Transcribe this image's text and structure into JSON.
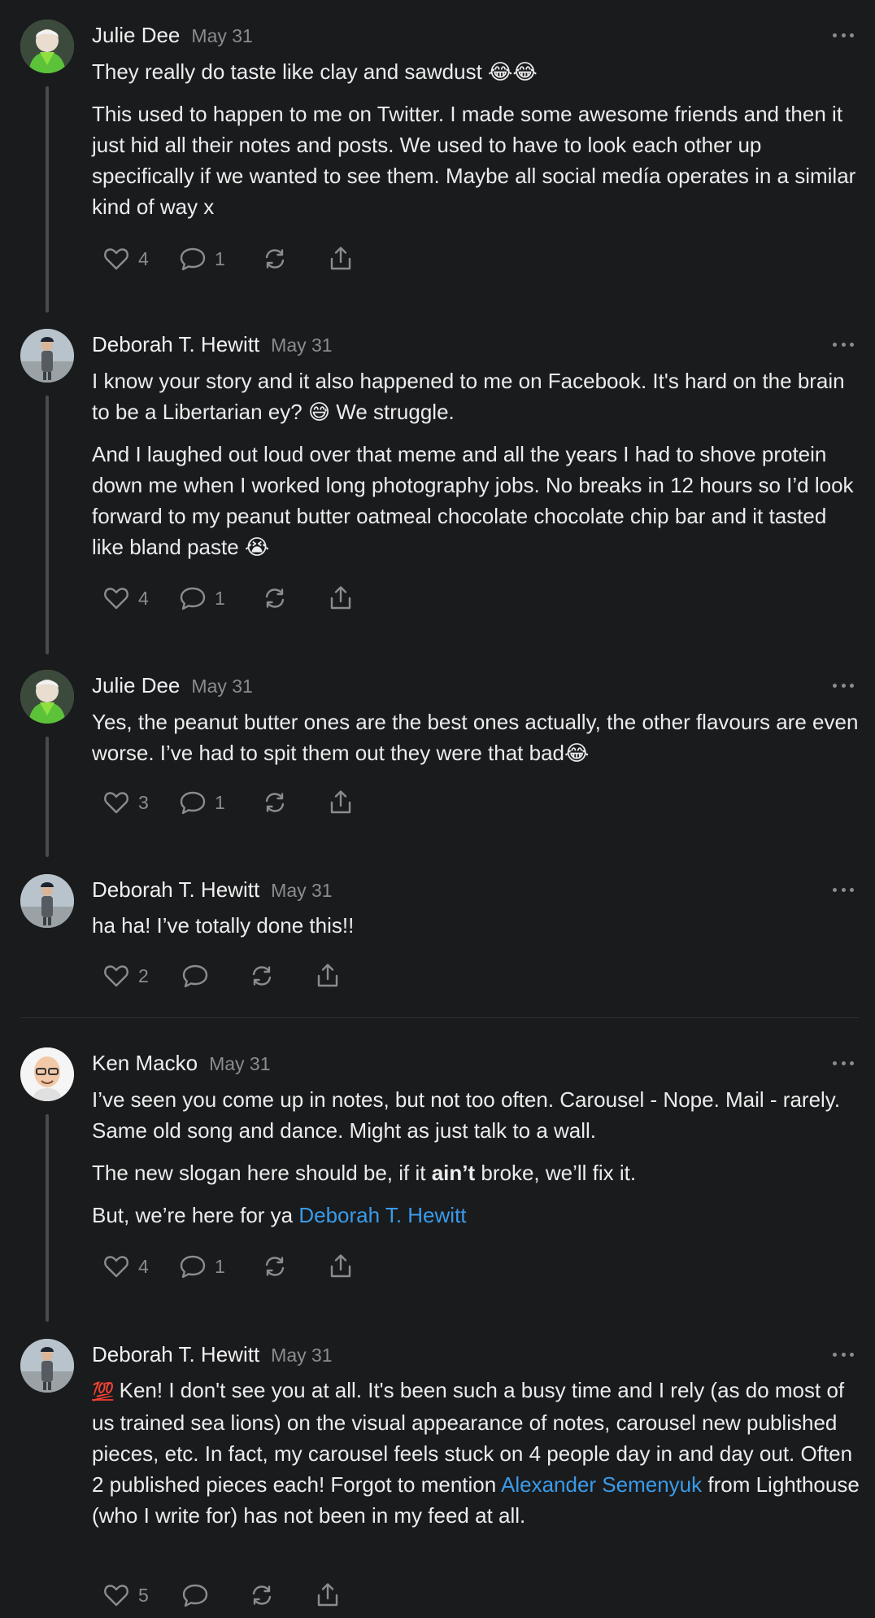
{
  "notes": [
    {
      "author": "Julie Dee",
      "date": "May 31",
      "paragraphs": [
        "They really do taste like clay and sawdust 😂😂",
        "This used to happen to me on Twitter. I made some awesome friends and then it just hid all their notes and posts. We used to have to look each other up specifically if we wanted to see them. Maybe all social medía operates in a similar kind of way x"
      ],
      "likes": "4",
      "comments": "1"
    },
    {
      "author": "Deborah T. Hewitt",
      "date": "May 31",
      "paragraphs": [
        "I know your story and it also happened to me on Facebook. It's hard on the brain to be a Libertarian ey? 😅 We struggle.",
        "And I laughed out loud over that meme and all the years I had to shove protein down me when I worked long photography jobs. No breaks in 12 hours so I’d look forward to my peanut butter oatmeal chocolate chocolate chip bar and it tasted like bland paste 😭"
      ],
      "likes": "4",
      "comments": "1"
    },
    {
      "author": "Julie Dee",
      "date": "May 31",
      "paragraphs": [
        "Yes, the peanut butter ones are the best ones actually, the other flavours are even worse. I’ve had to spit them out they were that bad😂"
      ],
      "likes": "3",
      "comments": "1"
    },
    {
      "author": "Deborah T. Hewitt",
      "date": "May 31",
      "paragraphs": [
        "ha ha! I’ve totally done this!!"
      ],
      "likes": "2",
      "comments": ""
    },
    {
      "author": "Ken Macko",
      "date": "May 31",
      "paragraphs": [
        "I’ve seen you come up in notes, but not too often. Carousel - Nope. Mail - rarely. Same old song and dance. Might as just talk to a wall."
      ],
      "slogan_before": "The new slogan here should be, if it ",
      "slogan_bold": "ain’t",
      "slogan_after": " broke, we’ll fix it.",
      "mention_before": "But, we’re here for ya ",
      "mention_link": "Deborah T. Hewitt",
      "likes": "4",
      "comments": "1"
    },
    {
      "author": "Deborah T. Hewitt",
      "date": "May 31",
      "hundred_emoji": "💯",
      "text_before_link": " Ken! I don't see you at all. It's been such a busy time and I rely (as do most of us trained sea lions) on the visual appearance of notes, carousel new published pieces, etc. In fact, my carousel feels stuck on 4 people day in and day out. Often 2 published pieces each! Forgot to mention ",
      "link_text": "Alexander Semenyuk",
      "text_after_link": " from Lighthouse (who I write for) has not been in my feed at all.",
      "likes": "5",
      "comments": ""
    }
  ],
  "icons": {
    "like": "heart-icon",
    "comment": "comment-icon",
    "restack": "restack-icon",
    "share": "share-icon",
    "more": "more-icon"
  },
  "colors": {
    "background": "#1a1b1d",
    "link": "#3a9be9",
    "muted": "#8b8c90",
    "thread_line": "#4a4b4e"
  }
}
